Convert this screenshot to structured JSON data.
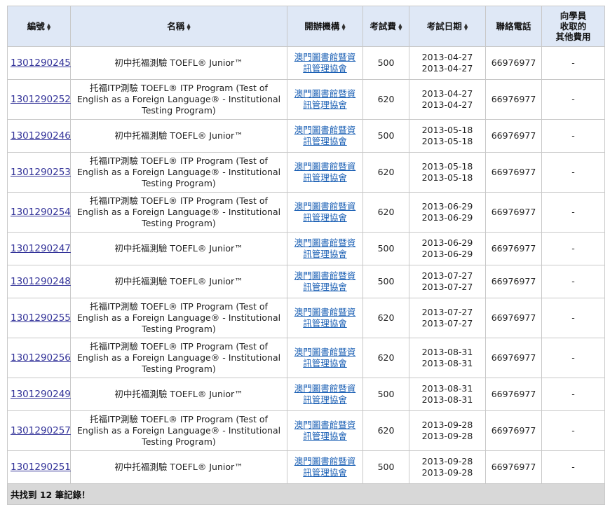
{
  "table": {
    "headers": {
      "id": "編號",
      "name": "名稱",
      "org": "開辦機構",
      "fee": "考試費",
      "date": "考試日期",
      "tel": "聯絡電話",
      "other_l1": "向學員",
      "other_l2": "收取的",
      "other_l3": "其他費用"
    },
    "rows": [
      {
        "id": "1301290245",
        "name": "初中托福測驗 TOEFL® Junior™",
        "org_l1": "澳門圖書館暨資",
        "org_l2": "訊管理協會",
        "fee": "500",
        "date_start": "2013-04-27",
        "date_end": "2013-04-27",
        "tel": "66976977",
        "other": "-"
      },
      {
        "id": "1301290252",
        "name": "托福ITP測驗 TOEFL® ITP Program (Test of English as a Foreign Language® - Institutional Testing Program)",
        "org_l1": "澳門圖書館暨資",
        "org_l2": "訊管理協會",
        "fee": "620",
        "date_start": "2013-04-27",
        "date_end": "2013-04-27",
        "tel": "66976977",
        "other": "-"
      },
      {
        "id": "1301290246",
        "name": "初中托福測驗 TOEFL® Junior™",
        "org_l1": "澳門圖書館暨資",
        "org_l2": "訊管理協會",
        "fee": "500",
        "date_start": "2013-05-18",
        "date_end": "2013-05-18",
        "tel": "66976977",
        "other": "-"
      },
      {
        "id": "1301290253",
        "name": "托福ITP測驗 TOEFL® ITP Program (Test of English as a Foreign Language® - Institutional Testing Program)",
        "org_l1": "澳門圖書館暨資",
        "org_l2": "訊管理協會",
        "fee": "620",
        "date_start": "2013-05-18",
        "date_end": "2013-05-18",
        "tel": "66976977",
        "other": "-"
      },
      {
        "id": "1301290254",
        "name": "托福ITP測驗 TOEFL® ITP Program (Test of English as a Foreign Language® - Institutional Testing Program)",
        "org_l1": "澳門圖書館暨資",
        "org_l2": "訊管理協會",
        "fee": "620",
        "date_start": "2013-06-29",
        "date_end": "2013-06-29",
        "tel": "66976977",
        "other": "-"
      },
      {
        "id": "1301290247",
        "name": "初中托福測驗 TOEFL® Junior™",
        "org_l1": "澳門圖書館暨資",
        "org_l2": "訊管理協會",
        "fee": "500",
        "date_start": "2013-06-29",
        "date_end": "2013-06-29",
        "tel": "66976977",
        "other": "-"
      },
      {
        "id": "1301290248",
        "name": "初中托福測驗 TOEFL® Junior™",
        "org_l1": "澳門圖書館暨資",
        "org_l2": "訊管理協會",
        "fee": "500",
        "date_start": "2013-07-27",
        "date_end": "2013-07-27",
        "tel": "66976977",
        "other": "-"
      },
      {
        "id": "1301290255",
        "name": "托福ITP測驗 TOEFL® ITP Program (Test of English as a Foreign Language® - Institutional Testing Program)",
        "org_l1": "澳門圖書館暨資",
        "org_l2": "訊管理協會",
        "fee": "620",
        "date_start": "2013-07-27",
        "date_end": "2013-07-27",
        "tel": "66976977",
        "other": "-"
      },
      {
        "id": "1301290256",
        "name": "托福ITP測驗 TOEFL® ITP Program (Test of English as a Foreign Language® - Institutional Testing Program)",
        "org_l1": "澳門圖書館暨資",
        "org_l2": "訊管理協會",
        "fee": "620",
        "date_start": "2013-08-31",
        "date_end": "2013-08-31",
        "tel": "66976977",
        "other": "-"
      },
      {
        "id": "1301290249",
        "name": "初中托福測驗 TOEFL® Junior™",
        "org_l1": "澳門圖書館暨資",
        "org_l2": "訊管理協會",
        "fee": "500",
        "date_start": "2013-08-31",
        "date_end": "2013-08-31",
        "tel": "66976977",
        "other": "-"
      },
      {
        "id": "1301290257",
        "name": "托福ITP測驗 TOEFL® ITP Program (Test of English as a Foreign Language® - Institutional Testing Program)",
        "org_l1": "澳門圖書館暨資",
        "org_l2": "訊管理協會",
        "fee": "620",
        "date_start": "2013-09-28",
        "date_end": "2013-09-28",
        "tel": "66976977",
        "other": "-"
      },
      {
        "id": "1301290251",
        "name": "初中托福測驗 TOEFL® Junior™",
        "org_l1": "澳門圖書館暨資",
        "org_l2": "訊管理協會",
        "fee": "500",
        "date_start": "2013-09-28",
        "date_end": "2013-09-28",
        "tel": "66976977",
        "other": "-"
      }
    ],
    "footer": "共找到 12 筆記錄！"
  },
  "icons": {
    "sort": "sort-arrows-icon"
  }
}
